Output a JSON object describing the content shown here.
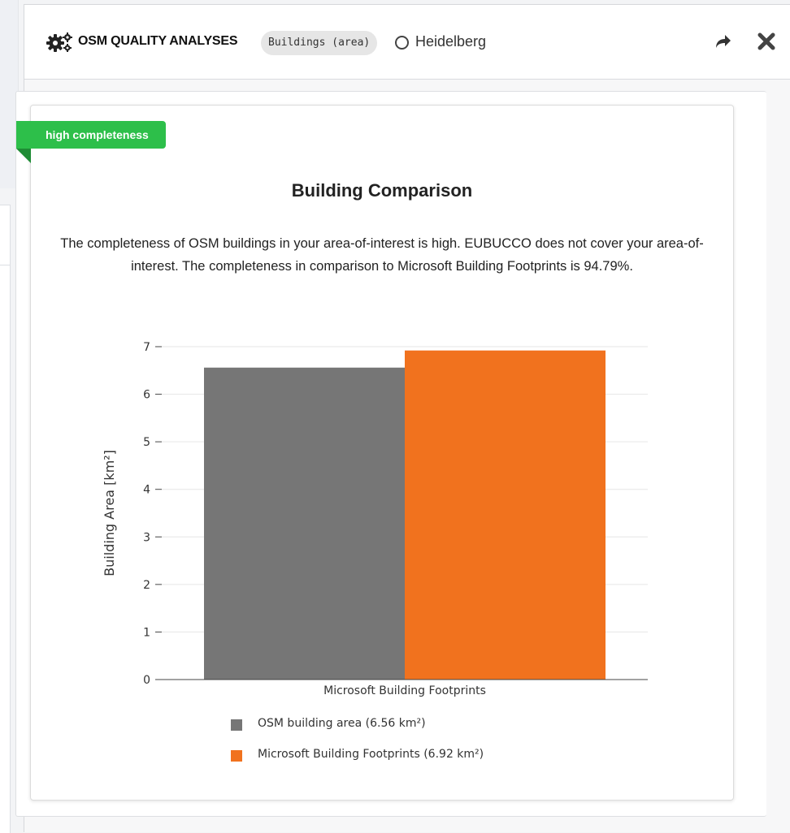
{
  "header": {
    "title": "OSM QUALITY ANALYSES",
    "topic_badge": "Buildings (area)",
    "region": "Heidelberg",
    "icons": [
      "gears-icon",
      "radio-icon",
      "share-icon",
      "close-icon"
    ]
  },
  "card": {
    "ribbon_label": "high completeness",
    "ribbon_color": "#2dbf4a",
    "heading": "Building Comparison",
    "text": "The completeness of OSM buildings in your area-of-interest is high. EUBUCCO does not cover your area-of-interest. The completeness in comparison to Microsoft Building Footprints is 94.79%."
  },
  "chart_data": {
    "type": "bar",
    "categories": [
      "Microsoft Building Footprints"
    ],
    "series": [
      {
        "name": "OSM building area (6.56 km²)",
        "values": [
          6.56
        ],
        "color": "#767676"
      },
      {
        "name": "Microsoft Building Footprints (6.92 km²)",
        "values": [
          6.92
        ],
        "color": "#f1721e"
      }
    ],
    "ylabel": "Building Area [km²]",
    "ylim": [
      0,
      7
    ],
    "yticks": [
      0,
      1,
      2,
      3,
      4,
      5,
      6,
      7
    ],
    "grid": true,
    "legend_position": "bottom"
  }
}
